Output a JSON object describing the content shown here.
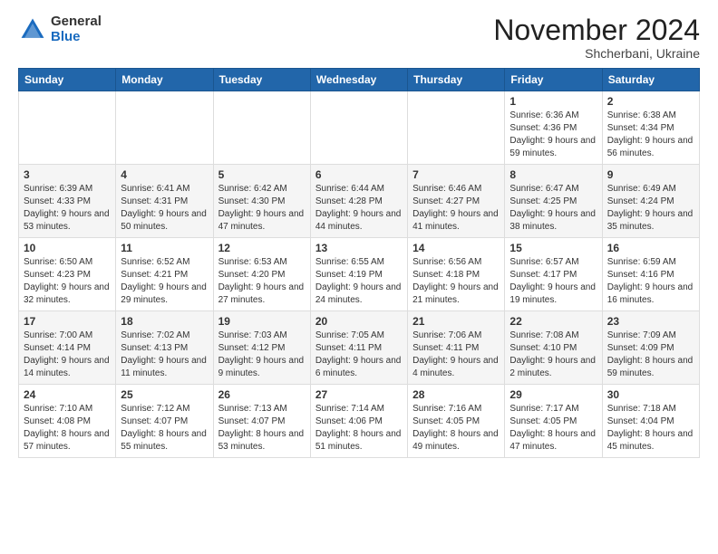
{
  "logo": {
    "general": "General",
    "blue": "Blue"
  },
  "header": {
    "month": "November 2024",
    "location": "Shcherbani, Ukraine"
  },
  "weekdays": [
    "Sunday",
    "Monday",
    "Tuesday",
    "Wednesday",
    "Thursday",
    "Friday",
    "Saturday"
  ],
  "weeks": [
    [
      null,
      null,
      null,
      null,
      null,
      {
        "day": 1,
        "sunrise": "6:36 AM",
        "sunset": "4:36 PM",
        "daylight": "9 hours and 59 minutes."
      },
      {
        "day": 2,
        "sunrise": "6:38 AM",
        "sunset": "4:34 PM",
        "daylight": "9 hours and 56 minutes."
      }
    ],
    [
      {
        "day": 3,
        "sunrise": "6:39 AM",
        "sunset": "4:33 PM",
        "daylight": "9 hours and 53 minutes."
      },
      {
        "day": 4,
        "sunrise": "6:41 AM",
        "sunset": "4:31 PM",
        "daylight": "9 hours and 50 minutes."
      },
      {
        "day": 5,
        "sunrise": "6:42 AM",
        "sunset": "4:30 PM",
        "daylight": "9 hours and 47 minutes."
      },
      {
        "day": 6,
        "sunrise": "6:44 AM",
        "sunset": "4:28 PM",
        "daylight": "9 hours and 44 minutes."
      },
      {
        "day": 7,
        "sunrise": "6:46 AM",
        "sunset": "4:27 PM",
        "daylight": "9 hours and 41 minutes."
      },
      {
        "day": 8,
        "sunrise": "6:47 AM",
        "sunset": "4:25 PM",
        "daylight": "9 hours and 38 minutes."
      },
      {
        "day": 9,
        "sunrise": "6:49 AM",
        "sunset": "4:24 PM",
        "daylight": "9 hours and 35 minutes."
      }
    ],
    [
      {
        "day": 10,
        "sunrise": "6:50 AM",
        "sunset": "4:23 PM",
        "daylight": "9 hours and 32 minutes."
      },
      {
        "day": 11,
        "sunrise": "6:52 AM",
        "sunset": "4:21 PM",
        "daylight": "9 hours and 29 minutes."
      },
      {
        "day": 12,
        "sunrise": "6:53 AM",
        "sunset": "4:20 PM",
        "daylight": "9 hours and 27 minutes."
      },
      {
        "day": 13,
        "sunrise": "6:55 AM",
        "sunset": "4:19 PM",
        "daylight": "9 hours and 24 minutes."
      },
      {
        "day": 14,
        "sunrise": "6:56 AM",
        "sunset": "4:18 PM",
        "daylight": "9 hours and 21 minutes."
      },
      {
        "day": 15,
        "sunrise": "6:57 AM",
        "sunset": "4:17 PM",
        "daylight": "9 hours and 19 minutes."
      },
      {
        "day": 16,
        "sunrise": "6:59 AM",
        "sunset": "4:16 PM",
        "daylight": "9 hours and 16 minutes."
      }
    ],
    [
      {
        "day": 17,
        "sunrise": "7:00 AM",
        "sunset": "4:14 PM",
        "daylight": "9 hours and 14 minutes."
      },
      {
        "day": 18,
        "sunrise": "7:02 AM",
        "sunset": "4:13 PM",
        "daylight": "9 hours and 11 minutes."
      },
      {
        "day": 19,
        "sunrise": "7:03 AM",
        "sunset": "4:12 PM",
        "daylight": "9 hours and 9 minutes."
      },
      {
        "day": 20,
        "sunrise": "7:05 AM",
        "sunset": "4:11 PM",
        "daylight": "9 hours and 6 minutes."
      },
      {
        "day": 21,
        "sunrise": "7:06 AM",
        "sunset": "4:11 PM",
        "daylight": "9 hours and 4 minutes."
      },
      {
        "day": 22,
        "sunrise": "7:08 AM",
        "sunset": "4:10 PM",
        "daylight": "9 hours and 2 minutes."
      },
      {
        "day": 23,
        "sunrise": "7:09 AM",
        "sunset": "4:09 PM",
        "daylight": "8 hours and 59 minutes."
      }
    ],
    [
      {
        "day": 24,
        "sunrise": "7:10 AM",
        "sunset": "4:08 PM",
        "daylight": "8 hours and 57 minutes."
      },
      {
        "day": 25,
        "sunrise": "7:12 AM",
        "sunset": "4:07 PM",
        "daylight": "8 hours and 55 minutes."
      },
      {
        "day": 26,
        "sunrise": "7:13 AM",
        "sunset": "4:07 PM",
        "daylight": "8 hours and 53 minutes."
      },
      {
        "day": 27,
        "sunrise": "7:14 AM",
        "sunset": "4:06 PM",
        "daylight": "8 hours and 51 minutes."
      },
      {
        "day": 28,
        "sunrise": "7:16 AM",
        "sunset": "4:05 PM",
        "daylight": "8 hours and 49 minutes."
      },
      {
        "day": 29,
        "sunrise": "7:17 AM",
        "sunset": "4:05 PM",
        "daylight": "8 hours and 47 minutes."
      },
      {
        "day": 30,
        "sunrise": "7:18 AM",
        "sunset": "4:04 PM",
        "daylight": "8 hours and 45 minutes."
      }
    ]
  ]
}
